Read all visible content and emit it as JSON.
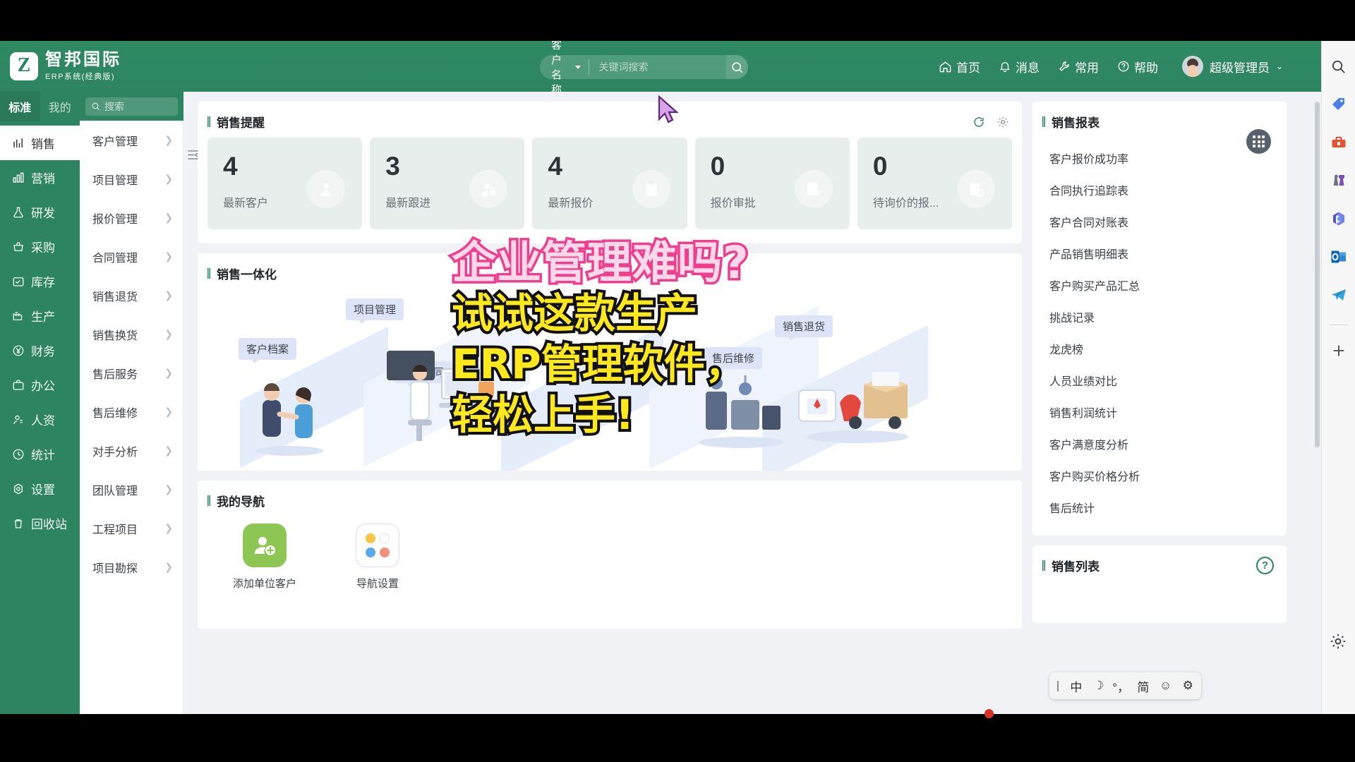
{
  "header": {
    "logo_text": "智邦国际",
    "logo_sub": "ERP系统(经典版)",
    "logo_mark": "Z",
    "search": {
      "category": "客户名称",
      "placeholder": "关键词搜索",
      "value": "",
      "search_icon": "search-icon"
    },
    "nav": [
      {
        "label": "首页",
        "icon": "home-icon"
      },
      {
        "label": "消息",
        "icon": "bell-icon"
      },
      {
        "label": "常用",
        "icon": "wrench-icon"
      },
      {
        "label": "帮助",
        "icon": "question-circle-icon"
      }
    ],
    "user": {
      "name": "超级管理员",
      "chevron": "⌄"
    }
  },
  "sidebar": {
    "tabs": [
      {
        "label": "标准",
        "active": true
      },
      {
        "label": "我的",
        "active": false
      }
    ],
    "search_placeholder": "搜索",
    "items": [
      {
        "label": "销售",
        "icon": "chart-line-icon",
        "active": true
      },
      {
        "label": "营销",
        "icon": "bar-chart-icon",
        "active": false
      },
      {
        "label": "研发",
        "icon": "flask-icon",
        "active": false
      },
      {
        "label": "采购",
        "icon": "basket-icon",
        "active": false
      },
      {
        "label": "库存",
        "icon": "box-icon",
        "active": false
      },
      {
        "label": "生产",
        "icon": "factory-icon",
        "active": false
      },
      {
        "label": "财务",
        "icon": "yuan-circle-icon",
        "active": false
      },
      {
        "label": "办公",
        "icon": "briefcase-icon",
        "active": false
      },
      {
        "label": "人资",
        "icon": "user-icon",
        "active": false
      },
      {
        "label": "统计",
        "icon": "clock-icon",
        "active": false
      },
      {
        "label": "设置",
        "icon": "gear-icon",
        "active": false
      },
      {
        "label": "回收站",
        "icon": "trash-icon",
        "active": false
      }
    ]
  },
  "submenu": {
    "items": [
      {
        "label": "客户管理"
      },
      {
        "label": "项目管理"
      },
      {
        "label": "报价管理"
      },
      {
        "label": "合同管理"
      },
      {
        "label": "销售退货"
      },
      {
        "label": "销售换货"
      },
      {
        "label": "售后服务"
      },
      {
        "label": "售后维修"
      },
      {
        "label": "对手分析"
      },
      {
        "label": "团队管理"
      },
      {
        "label": "工程项目"
      },
      {
        "label": "项目勘探"
      }
    ]
  },
  "reminders": {
    "title": "销售提醒",
    "refresh_icon": "refresh-icon",
    "settings_icon": "gear-icon",
    "cards": [
      {
        "value": "4",
        "label": "最新客户",
        "icon": "user-circle-icon"
      },
      {
        "value": "3",
        "label": "最新跟进",
        "icon": "user-lock-icon"
      },
      {
        "value": "4",
        "label": "最新报价",
        "icon": "quote-icon"
      },
      {
        "value": "0",
        "label": "报价审批",
        "icon": "quote-approve-icon"
      },
      {
        "value": "0",
        "label": "待询价的报...",
        "icon": "quote-pending-icon"
      }
    ]
  },
  "integration": {
    "title": "销售一体化",
    "labels": [
      {
        "text": "客户档案"
      },
      {
        "text": "项目管理"
      },
      {
        "text": "销售合同"
      },
      {
        "text": "售后维修"
      },
      {
        "text": "销售退货"
      }
    ]
  },
  "mynav": {
    "title": "我的导航",
    "tiles": [
      {
        "label": "添加单位客户",
        "icon": "add-user-icon",
        "color": "#8dc653"
      },
      {
        "label": "导航设置",
        "icon": "four-dots-icon",
        "colors": [
          "#f5c543",
          "#ffffff",
          "#5aa9e6",
          "#f1907b"
        ]
      }
    ]
  },
  "reports": {
    "title": "销售报表",
    "items": [
      {
        "label": "客户报价成功率"
      },
      {
        "label": "合同执行追踪表"
      },
      {
        "label": "客户合同对账表"
      },
      {
        "label": "产品销售明细表"
      },
      {
        "label": "客户购买产品汇总"
      },
      {
        "label": "挑战记录"
      },
      {
        "label": "龙虎榜"
      },
      {
        "label": "人员业绩对比"
      },
      {
        "label": "销售利润统计"
      },
      {
        "label": "客户满意度分析"
      },
      {
        "label": "客户购买价格分析"
      },
      {
        "label": "售后统计"
      }
    ]
  },
  "saleslist": {
    "title": "销售列表",
    "help_badge": "?"
  },
  "floating": {
    "grid_button_icon": "grid-apps-icon"
  },
  "os_rail": {
    "icons": [
      "search-icon",
      "tag-icon",
      "toolbox-icon",
      "chess-icon",
      "microsoft365-icon",
      "outlook-icon",
      "telegram-icon"
    ],
    "add_icon": "plus-icon",
    "settings_icon": "gear-icon"
  },
  "ime": {
    "keys": [
      "中",
      "☽",
      "°，",
      "简",
      "☺",
      "⚙"
    ],
    "icon_names": [
      "chinese-mode",
      "moon-icon",
      "punctuation-icon",
      "simplified-icon",
      "emoji-icon",
      "gear-icon"
    ]
  },
  "promo": {
    "line1": "企业管理难吗?",
    "line2": "试试这款生产",
    "line3": "ERP管理软件，",
    "line4": "轻松上手!"
  },
  "colors": {
    "brand_green": "#2d8461",
    "promo_pink": "#ef3e8e",
    "promo_yellow": "#ffe81c",
    "card_bg": "#e8eeeb",
    "page_bg": "#f0f2f5"
  }
}
